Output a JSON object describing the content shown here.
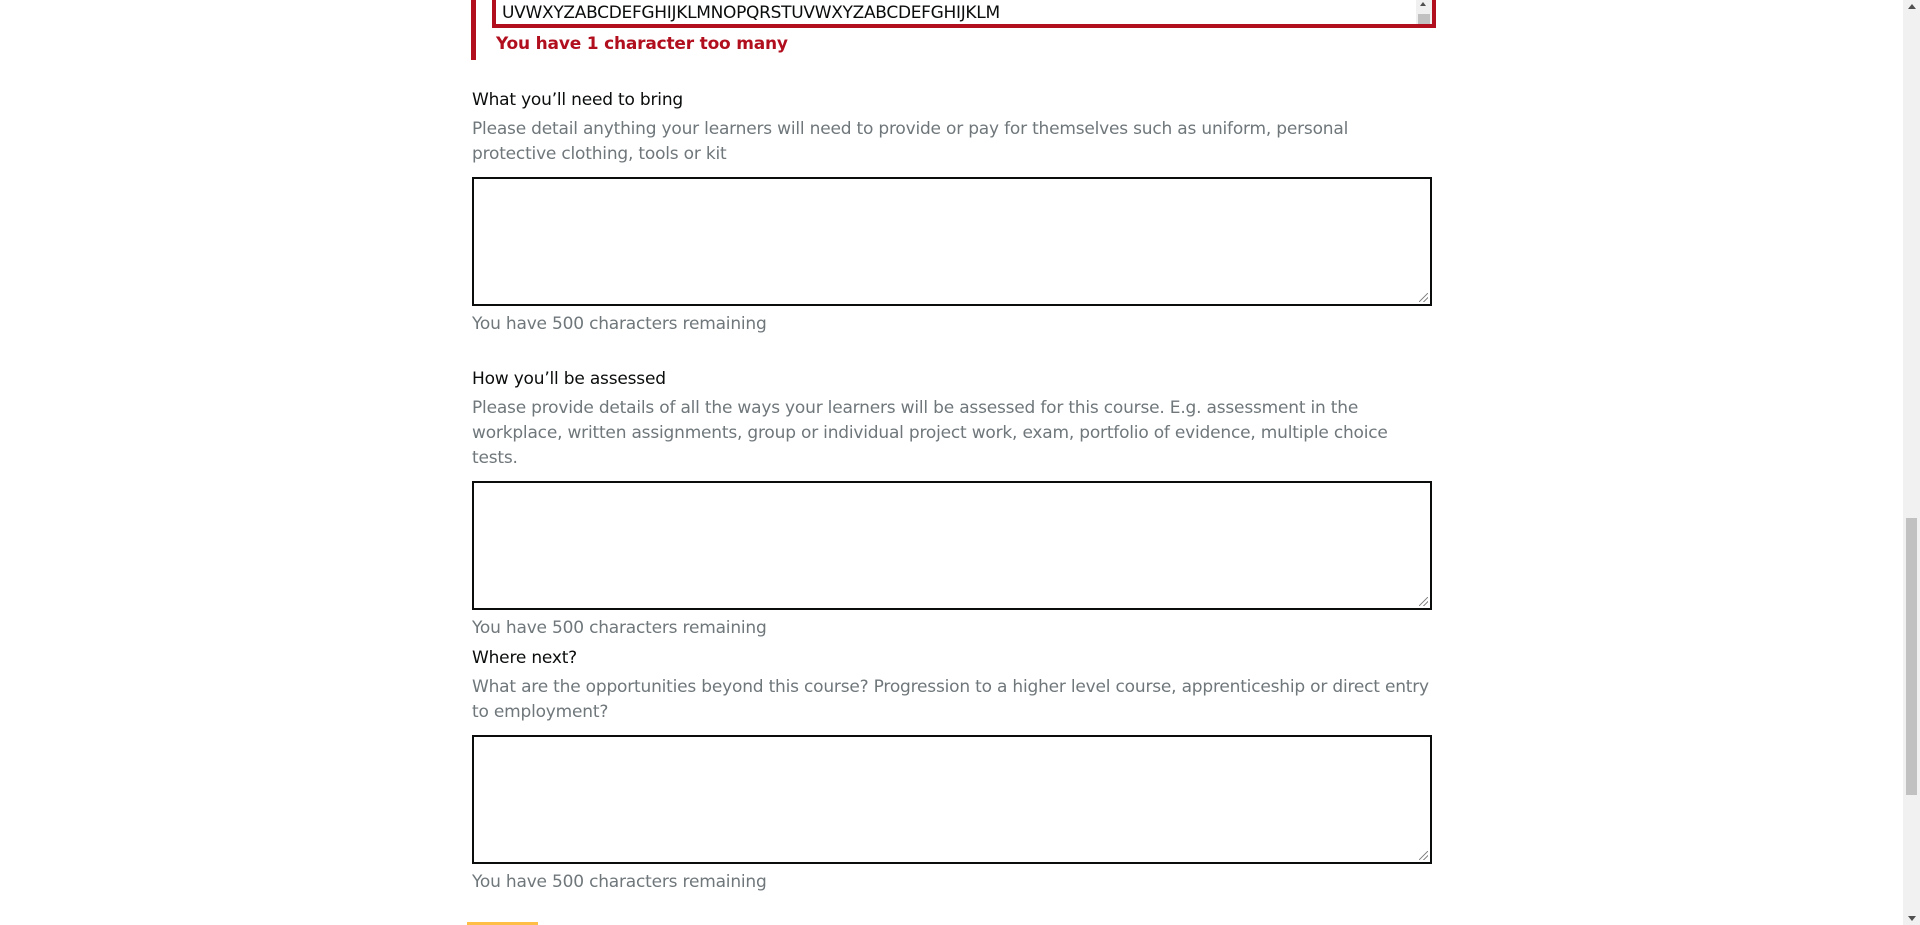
{
  "error_field": {
    "value_tail": "UVWXYZABCDEFGHIJKLMNOPQRSTUVWXYZABCDEFGHIJKLM",
    "error_message": "You have 1 character too many"
  },
  "fields": [
    {
      "label": "What you’ll need to bring",
      "hint": "Please detail anything your learners will need to provide or pay for themselves such as uniform, personal protective clothing, tools or kit",
      "value": "",
      "counter": "You have 500 characters remaining"
    },
    {
      "label": "How you’ll be assessed",
      "hint": "Please provide details of all the ways your learners will be assessed for this course. E.g. assessment in the workplace, written assignments, group or individual project work, exam, portfolio of evidence, multiple choice tests.",
      "value": "",
      "counter": "You have 500 characters remaining"
    },
    {
      "label": "Where next?",
      "hint": "What are the opportunities beyond this course? Progression to a higher level course, apprenticeship or direct entry to employment?",
      "value": "",
      "counter": "You have 500 characters remaining"
    }
  ],
  "colors": {
    "error": "#b10e1e",
    "hint": "#6f777b",
    "text": "#0b0c0c",
    "focus_stub": "#ffbf47"
  }
}
